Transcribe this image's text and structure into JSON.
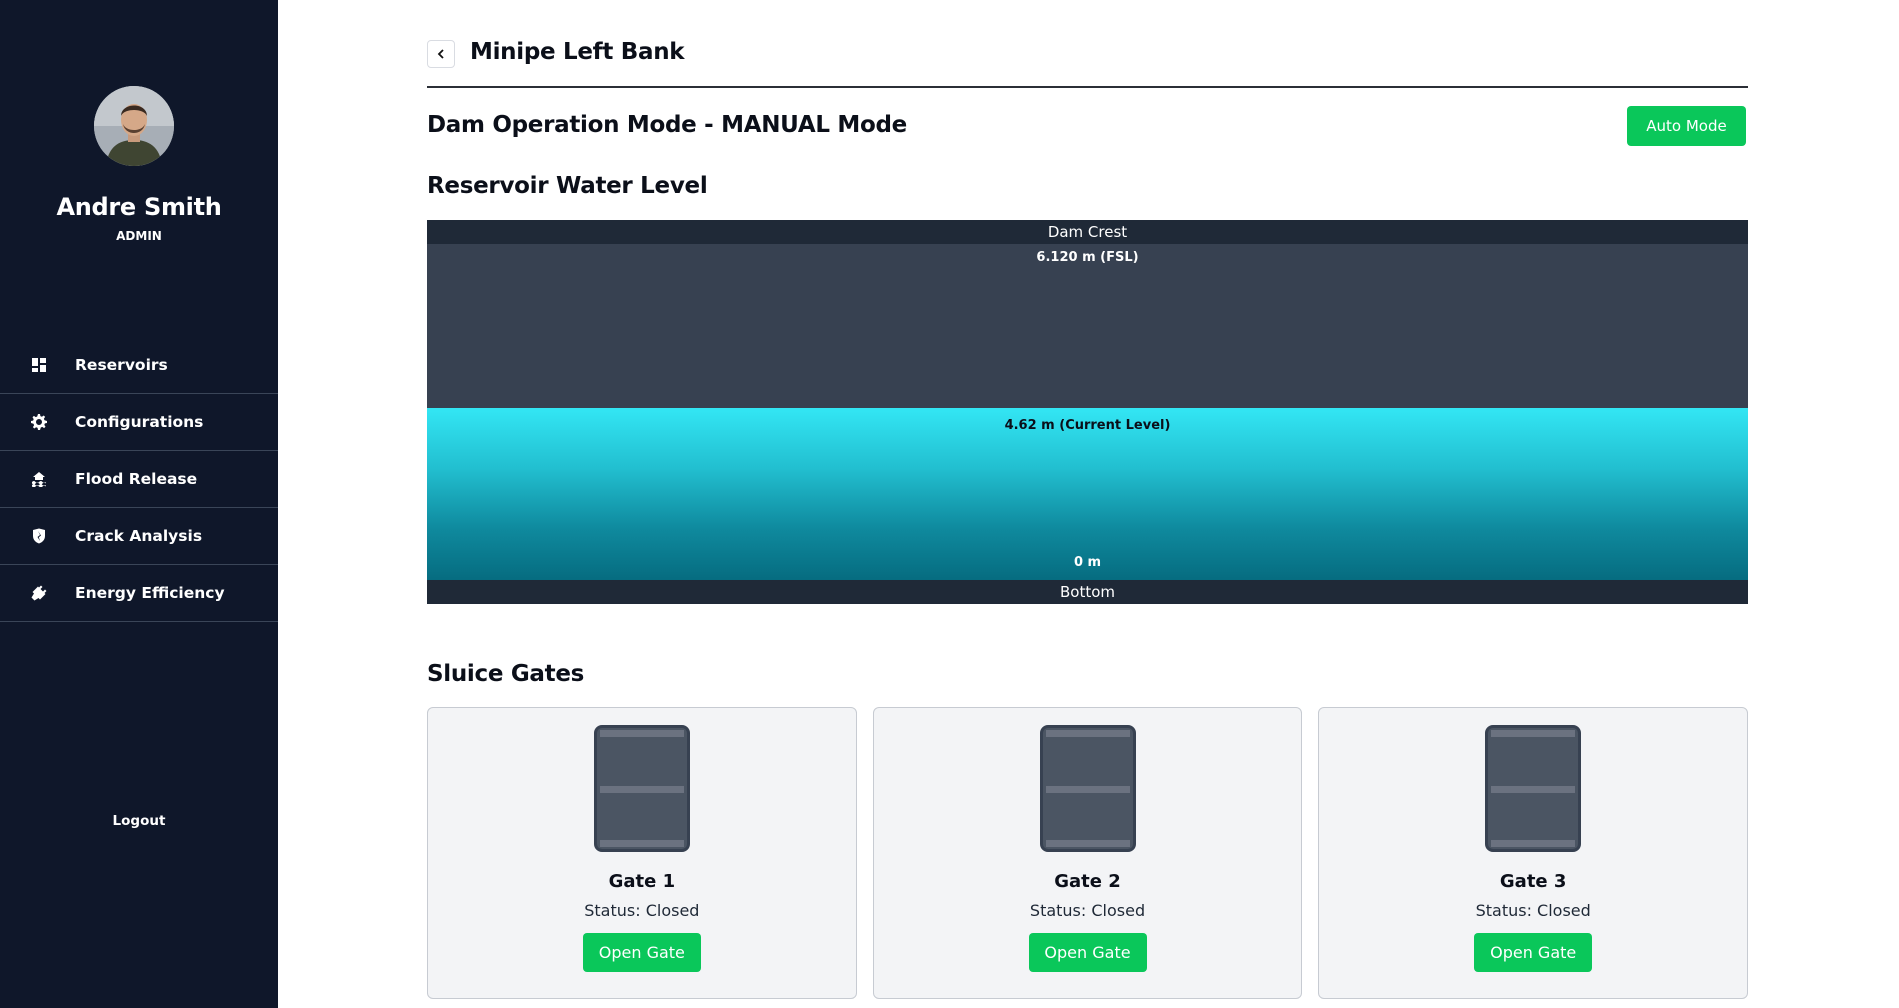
{
  "user": {
    "name": "Andre Smith",
    "role": "ADMIN"
  },
  "sidebar": {
    "items": [
      {
        "label": "Reservoirs",
        "icon": "dashboard-icon"
      },
      {
        "label": "Configurations",
        "icon": "gear-icon"
      },
      {
        "label": "Flood Release",
        "icon": "flood-icon"
      },
      {
        "label": "Crack Analysis",
        "icon": "shield-crack-icon"
      },
      {
        "label": "Energy Efficiency",
        "icon": "plug-icon"
      }
    ],
    "logout_label": "Logout"
  },
  "header": {
    "title": "Minipe Left Bank"
  },
  "mode": {
    "heading": "Dam Operation Mode - MANUAL Mode",
    "toggle_label": "Auto Mode"
  },
  "reservoir": {
    "heading": "Reservoir Water Level",
    "crest_label": "Dam Crest",
    "fsl_label": "6.120 m (FSL)",
    "fsl_value": 6.12,
    "current_label": "4.62 m (Current Level)",
    "current_value": 4.62,
    "zero_label": "0 m",
    "bottom_label": "Bottom"
  },
  "gates": {
    "heading": "Sluice Gates",
    "items": [
      {
        "name": "Gate 1",
        "status": "Status: Closed",
        "action": "Open Gate"
      },
      {
        "name": "Gate 2",
        "status": "Status: Closed",
        "action": "Open Gate"
      },
      {
        "name": "Gate 3",
        "status": "Status: Closed",
        "action": "Open Gate"
      }
    ]
  },
  "colors": {
    "sidebar_bg": "#0f172a",
    "accent_green": "#0ac75a",
    "water_top": "#33e6f4",
    "water_bottom": "#066c80"
  }
}
